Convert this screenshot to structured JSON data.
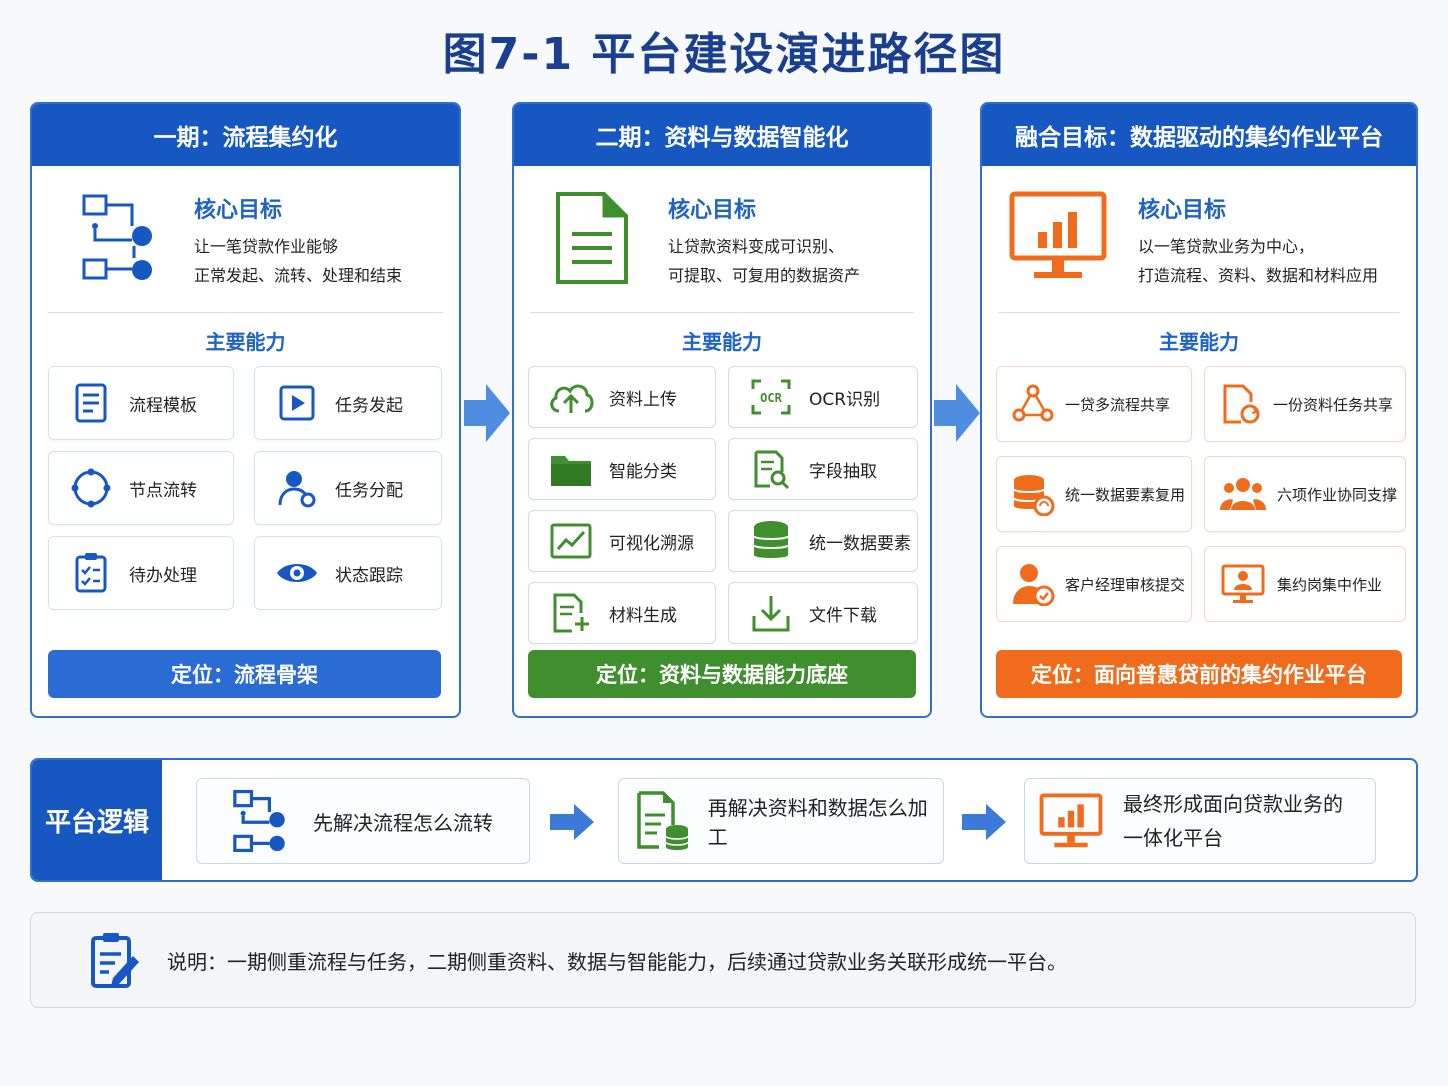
{
  "title": "图7-1  平台建设演进路径图",
  "phases": [
    {
      "header": "一期：流程集约化",
      "goal_title": "核心目标",
      "goal_line1": "让一笔贷款作业能够",
      "goal_line2": "正常发起、流转、处理和结束",
      "cap_title": "主要能力",
      "caps": [
        "流程模板",
        "任务发起",
        "节点流转",
        "任务分配",
        "待办处理",
        "状态跟踪"
      ],
      "position": "定位：流程骨架"
    },
    {
      "header": "二期：资料与数据智能化",
      "goal_title": "核心目标",
      "goal_line1": "让贷款资料变成可识别、",
      "goal_line2": "可提取、可复用的数据资产",
      "cap_title": "主要能力",
      "caps": [
        "资料上传",
        "OCR识别",
        "智能分类",
        "字段抽取",
        "可视化溯源",
        "统一数据要素",
        "材料生成",
        "文件下载"
      ],
      "ocr_icon_text": "OCR",
      "position": "定位：资料与数据能力底座"
    },
    {
      "header": "融合目标：数据驱动的集约作业平台",
      "goal_title": "核心目标",
      "goal_line1": "以一笔贷款业务为中心，",
      "goal_line2": "打造流程、资料、数据和材料应用",
      "cap_title": "主要能力",
      "caps": [
        "一贷多流程共享",
        "一份资料任务共享",
        "统一数据要素复用",
        "六项作业协同支撑",
        "客户经理审核提交",
        "集约岗集中作业"
      ],
      "position": "定位：面向普惠贷前的集约作业平台"
    }
  ],
  "logic": {
    "header": "平台逻辑",
    "steps": [
      "先解决流程怎么流转",
      "再解决资料和数据怎么加工"
    ],
    "final_line1": "最终形成面向贷款业务的",
    "final_line2": "一体化平台"
  },
  "note": "说明：一期侧重流程与任务，二期侧重资料、数据与智能能力，后续通过贷款业务关联形成统一平台。",
  "colors": {
    "blue": "#1757c2",
    "green": "#3f8f2f",
    "orange": "#f06b1c"
  }
}
